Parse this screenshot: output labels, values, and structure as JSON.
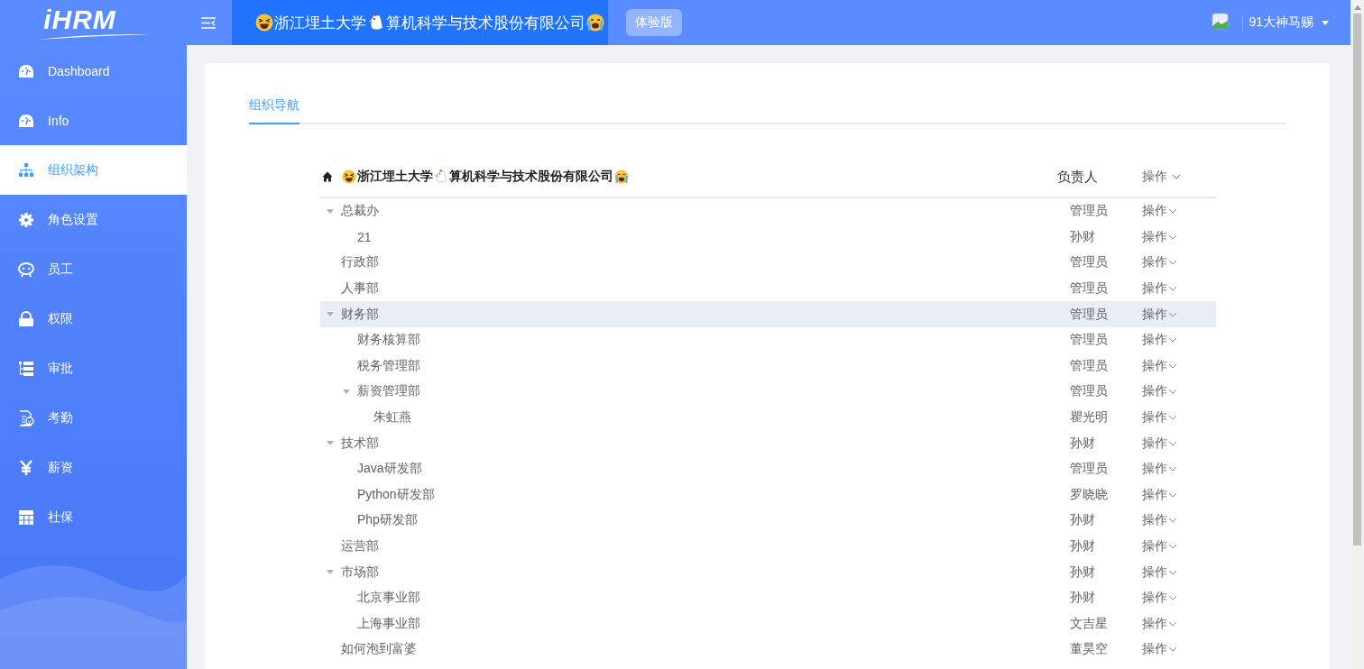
{
  "logo": "iHRM",
  "header": {
    "company": {
      "part_1": "浙江埋土大学",
      "part_2": "算机科学与技术股份有限公司"
    },
    "badge": "体验版",
    "user": "91大神马赐"
  },
  "sidebar": {
    "items": [
      {
        "label": "Dashboard",
        "selected": false
      },
      {
        "label": "Info",
        "selected": false
      },
      {
        "label": "组织架构",
        "selected": true
      },
      {
        "label": "角色设置",
        "selected": false
      },
      {
        "label": "员工",
        "selected": false
      },
      {
        "label": "权限",
        "selected": false
      },
      {
        "label": "审批",
        "selected": false
      },
      {
        "label": "考勤",
        "selected": false
      },
      {
        "label": "薪资",
        "selected": false
      },
      {
        "label": "社保",
        "selected": false
      }
    ]
  },
  "tabs": [
    {
      "label": "组织导航",
      "selected": true
    }
  ],
  "tree_header": {
    "company": {
      "part_1": "浙江埋土大学",
      "part_2": "算机科学与技术股份有限公司"
    },
    "manager_heading": "负责人",
    "action": "操作"
  },
  "tree": [
    {
      "name": "总裁办",
      "manager": "管理员",
      "action": "操作",
      "hovered": false,
      "expanded": true,
      "children": [
        {
          "name": "21",
          "manager": "孙财",
          "action": "操作",
          "hovered": false
        }
      ]
    },
    {
      "name": "行政部",
      "manager": "管理员",
      "action": "操作",
      "hovered": false
    },
    {
      "name": "人事部",
      "manager": "管理员",
      "action": "操作",
      "hovered": false
    },
    {
      "name": "财务部",
      "manager": "管理员",
      "action": "操作",
      "hovered": true,
      "expanded": true,
      "children": [
        {
          "name": "财务核算部",
          "manager": "管理员",
          "action": "操作",
          "hovered": false
        },
        {
          "name": "税务管理部",
          "manager": "管理员",
          "action": "操作",
          "hovered": false
        },
        {
          "name": "薪资管理部",
          "manager": "管理员",
          "action": "操作",
          "hovered": false,
          "expanded": true,
          "children": [
            {
              "name": "朱虹燕",
              "manager": "瞿光明",
              "action": "操作",
              "hovered": false
            }
          ]
        }
      ]
    },
    {
      "name": "技术部",
      "manager": "孙财",
      "action": "操作",
      "hovered": false,
      "expanded": true,
      "children": [
        {
          "name": "Java研发部",
          "manager": "管理员",
          "action": "操作",
          "hovered": false
        },
        {
          "name": "Python研发部",
          "manager": "罗晓晓",
          "action": "操作",
          "hovered": false
        },
        {
          "name": "Php研发部",
          "manager": "孙财",
          "action": "操作",
          "hovered": false
        }
      ]
    },
    {
      "name": "运营部",
      "manager": "孙财",
      "action": "操作",
      "hovered": false
    },
    {
      "name": "市场部",
      "manager": "孙财",
      "action": "操作",
      "hovered": false,
      "expanded": true,
      "children": [
        {
          "name": "北京事业部",
          "manager": "孙财",
          "action": "操作",
          "hovered": false
        },
        {
          "name": "上海事业部",
          "manager": "文吉星",
          "action": "操作",
          "hovered": false
        }
      ]
    },
    {
      "name": "如何泡到富婆",
      "manager": "董昊空",
      "action": "操作",
      "hovered": false
    }
  ]
}
